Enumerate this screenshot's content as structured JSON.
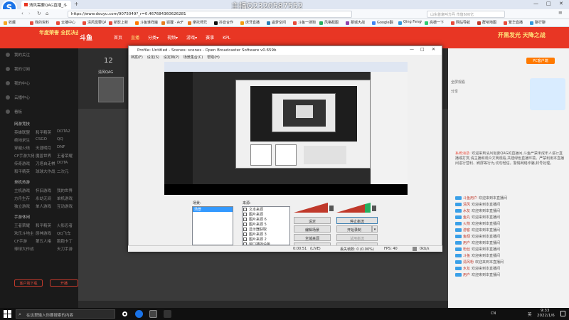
{
  "browser": {
    "tabs": [
      {
        "label": "清风需要QAG直播_斗"
      }
    ],
    "streamer_overlay": "主播Q2320587552",
    "url": "https://www.douyu.com/9075049?_r=0.467684360626281",
    "search_placeholder": "山东首富叫方丹 市值600亿",
    "bookmarks": [
      {
        "label": "收藏",
        "color": "#f5a623"
      },
      {
        "label": "我的资料",
        "color": "#e74c3c"
      },
      {
        "label": "云播中心",
        "color": "#e74c3c"
      },
      {
        "label": "清风需要QA",
        "color": "#e74c3c"
      },
      {
        "label": "新影上新",
        "color": "#e74c3c"
      },
      {
        "label": "斗鱼谁样魔",
        "color": "#ff7a00"
      },
      {
        "label": "狐狸 · AcF",
        "color": "#e67e22"
      },
      {
        "label": "摩托师兄",
        "color": "#e67e22"
      },
      {
        "label": "抖音合作",
        "color": "#111111"
      },
      {
        "label": "虎牙直播",
        "color": "#f39c12"
      },
      {
        "label": "盗梦空间",
        "color": "#2980b9"
      },
      {
        "label": "斗鱼一搜狗",
        "color": "#e74c3c"
      },
      {
        "label": "风格截图",
        "color": "#27ae60"
      },
      {
        "label": "慕城大战",
        "color": "#8e44ad"
      },
      {
        "label": "Google翻",
        "color": "#4285f4"
      },
      {
        "label": "Qing FengQ",
        "color": "#3498db"
      },
      {
        "label": "高德一下",
        "color": "#2ecc71"
      },
      {
        "label": "网站导航",
        "color": "#e74c3c"
      },
      {
        "label": "群吧地图",
        "color": "#c0392b"
      },
      {
        "label": "繁华直播",
        "color": "#e74c3c"
      },
      {
        "label": "聊行聊",
        "color": "#3498db"
      }
    ]
  },
  "site": {
    "logo": "斗鱼",
    "nav": [
      "首页",
      "直播",
      "分类▾",
      "视频▾",
      "游戏▾",
      "赛事",
      "KPL"
    ],
    "banner_left": "年度荣誉 全民决战",
    "banner_right": "开黑发光 天降之战",
    "sidebar": {
      "items": [
        "我的关注",
        "我的订阅",
        "我的中心",
        "云播中心",
        "看板"
      ],
      "sections": [
        {
          "title": "网游竞技",
          "games": [
            [
              "英雄联盟",
              "和平精英",
              "DOTA2"
            ],
            [
              "绝地求生",
              "CSGO",
              "QQ"
            ],
            [
              "穿越火线",
              "天涯明月",
              "DNF"
            ],
            [
              "CF手游大佬",
              "魔兽世界",
              "王者荣耀"
            ],
            [
              "传奇游戏",
              "刀塔自走棋",
              "DOTA"
            ],
            [
              "和平精英",
              "球球大作战",
              "二次元"
            ]
          ]
        },
        {
          "title": "单机热游",
          "games": [
            [
              "主机游戏",
              "怀旧游戏",
              "我的世界"
            ],
            [
              "方舟生存",
              "永劫无间",
              "单机游戏"
            ],
            [
              "独立游戏",
              "单人游戏",
              "互动游戏"
            ]
          ]
        },
        {
          "title": "手游休闲",
          "games": [
            [
              "王者荣耀",
              "和平精英",
              "火影忍者"
            ],
            [
              "欢乐斗地主",
              "原神游戏",
              "QQ飞车"
            ],
            [
              "CF手游",
              "第五人格",
              "跑跑卡丁"
            ],
            [
              "球球大作战",
              "",
              "天刀手游"
            ]
          ]
        }
      ],
      "bottom_buttons": [
        "客户端下载",
        "开播"
      ]
    },
    "room": {
      "level": "12",
      "streamer_label": "清风QAG",
      "follow_label": "PC客户端"
    },
    "chat": {
      "header": [
        "全屏观看",
        "分享"
      ],
      "notice_name": "系统消息:",
      "notice": "欢迎来到清风需要QAG的直播间,斗鱼严禁未成年人进行直播或打赏,请主播和观众文明观看,共建绿色直播环境。严禁利用本直播间进行营利、刷屏等行为,切勿轻信。警惕网络诈骗,封号处理。",
      "lines": [
        {
          "name": "斗鱼用户",
          "text": "欢迎来到本直播间"
        },
        {
          "name": "清风",
          "text": "欢迎来到本直播间"
        },
        {
          "name": "水友",
          "text": "欢迎来到本直播间"
        },
        {
          "name": "鱼丸",
          "text": "欢迎来到本直播间"
        },
        {
          "name": "火箭",
          "text": "欢迎来到本直播间"
        },
        {
          "name": "游客",
          "text": "欢迎来到本直播间"
        },
        {
          "name": "鱼翅",
          "text": "欢迎来到本直播间"
        },
        {
          "name": "用户",
          "text": "欢迎来到本直播间"
        },
        {
          "name": "粉丝",
          "text": "欢迎来到本直播间"
        },
        {
          "name": "斗鱼",
          "text": "欢迎来到本直播间"
        },
        {
          "name": "清风粉",
          "text": "欢迎来到本直播间"
        },
        {
          "name": "水友",
          "text": "欢迎来到本直播间"
        },
        {
          "name": "用户",
          "text": "欢迎来到本直播间"
        }
      ]
    }
  },
  "obs": {
    "title": "Profile: Untitled - Scenes: scenes - Open Broadcaster Software v0.659b",
    "menu": [
      "档案(F)",
      "设定(S)",
      "设定档(P)",
      "场景集合(C)",
      "帮助(H)"
    ],
    "scenes_label": "场景:",
    "scenes": [
      "场景"
    ],
    "sources_label": "来源:",
    "sources": [
      "文本来源",
      "图片来源",
      "图片来源 6",
      "图片来源 5",
      "显示器获取",
      "图片来源 3",
      "图片来源 2",
      "窗口捕捉设备"
    ],
    "buttons": {
      "settings": "设定",
      "stop_stream": "停止串流",
      "edit_scene": "编辑场景",
      "start_record": "开始录制",
      "global_sources": "全域来源",
      "test_stream": "试用串流",
      "plugins": "插件",
      "exit": "退出"
    },
    "status": {
      "time": "0:00:51",
      "state": "(LIVE)",
      "dropped": "丢失帧数: 0 (0.00%)",
      "fps": "FPS: 40",
      "bitrate": "0kb/s"
    }
  },
  "taskbar": {
    "search_placeholder": "在这里输入你要搜索的内容",
    "lang": "英",
    "time": "9:33",
    "date": "2022/1/6",
    "tray": "CN"
  }
}
